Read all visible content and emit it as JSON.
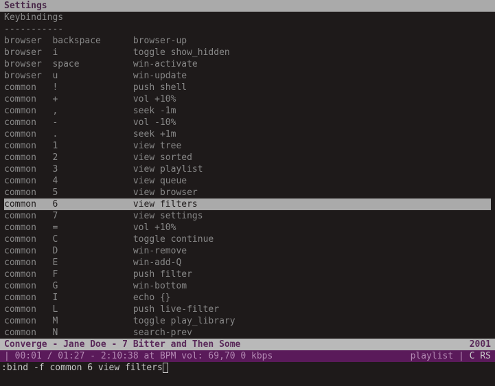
{
  "title": "Settings",
  "section_header": "Keybindings",
  "divider": "-----------",
  "bindings": [
    {
      "ctx": "browser",
      "key": "backspace",
      "cmd": "browser-up",
      "sel": false
    },
    {
      "ctx": "browser",
      "key": "i",
      "cmd": "toggle show_hidden",
      "sel": false
    },
    {
      "ctx": "browser",
      "key": "space",
      "cmd": "win-activate",
      "sel": false
    },
    {
      "ctx": "browser",
      "key": "u",
      "cmd": "win-update",
      "sel": false
    },
    {
      "ctx": "common",
      "key": "!",
      "cmd": "push shell",
      "sel": false
    },
    {
      "ctx": "common",
      "key": "+",
      "cmd": "vol +10%",
      "sel": false
    },
    {
      "ctx": "common",
      "key": ",",
      "cmd": "seek -1m",
      "sel": false
    },
    {
      "ctx": "common",
      "key": "-",
      "cmd": "vol -10%",
      "sel": false
    },
    {
      "ctx": "common",
      "key": ".",
      "cmd": "seek +1m",
      "sel": false
    },
    {
      "ctx": "common",
      "key": "1",
      "cmd": "view tree",
      "sel": false
    },
    {
      "ctx": "common",
      "key": "2",
      "cmd": "view sorted",
      "sel": false
    },
    {
      "ctx": "common",
      "key": "3",
      "cmd": "view playlist",
      "sel": false
    },
    {
      "ctx": "common",
      "key": "4",
      "cmd": "view queue",
      "sel": false
    },
    {
      "ctx": "common",
      "key": "5",
      "cmd": "view browser",
      "sel": false
    },
    {
      "ctx": "common",
      "key": "6",
      "cmd": "view filters",
      "sel": true
    },
    {
      "ctx": "common",
      "key": "7",
      "cmd": "view settings",
      "sel": false
    },
    {
      "ctx": "common",
      "key": "=",
      "cmd": "vol +10%",
      "sel": false
    },
    {
      "ctx": "common",
      "key": "C",
      "cmd": "toggle continue",
      "sel": false
    },
    {
      "ctx": "common",
      "key": "D",
      "cmd": "win-remove",
      "sel": false
    },
    {
      "ctx": "common",
      "key": "E",
      "cmd": "win-add-Q",
      "sel": false
    },
    {
      "ctx": "common",
      "key": "F",
      "cmd": "push filter",
      "sel": false
    },
    {
      "ctx": "common",
      "key": "G",
      "cmd": "win-bottom",
      "sel": false
    },
    {
      "ctx": "common",
      "key": "I",
      "cmd": "echo {}",
      "sel": false
    },
    {
      "ctx": "common",
      "key": "L",
      "cmd": "push live-filter",
      "sel": false
    },
    {
      "ctx": "common",
      "key": "M",
      "cmd": "toggle play_library",
      "sel": false
    },
    {
      "ctx": "common",
      "key": "N",
      "cmd": "search-prev",
      "sel": false
    }
  ],
  "now_playing": {
    "text": "Converge - Jane Doe - 7 Bitter and Then Some",
    "year": "2001"
  },
  "status": {
    "left": "| 00:01 / 01:27 - 2:10:38 at  BPM vol: 69,70  0 kbps",
    "right_label": "playlist |",
    "right_flags": " C RS"
  },
  "command": ":bind -f common 6 view filters"
}
